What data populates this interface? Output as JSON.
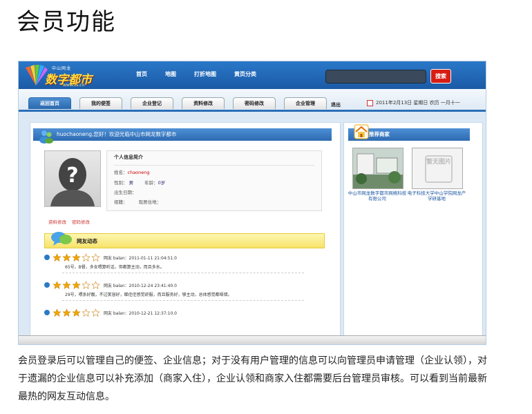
{
  "page_title": "会员功能",
  "site": {
    "logo_text": "数字都市",
    "logo_sub": "中山网龙",
    "logo_url": "www.zs.cn",
    "nav": [
      "首页",
      "地图",
      "打折地图",
      "黄页分类"
    ],
    "search_button": "搜索"
  },
  "tabs": [
    {
      "label": "返回首页",
      "active": true
    },
    {
      "label": "我的便签",
      "active": false
    },
    {
      "label": "企业登记",
      "active": false
    },
    {
      "label": "资料修改",
      "active": false
    },
    {
      "label": "密码修改",
      "active": false
    },
    {
      "label": "企业管理",
      "active": false
    }
  ],
  "logout": "退出",
  "date": "2011年2月13日  星期日  农历 一月十一",
  "welcome": "huochaoneng,您好！欢迎光临中山市网龙数字都市",
  "profile": {
    "title": "个人信息简介",
    "name_label": "姓名：",
    "name_value": "chaoneng",
    "gender_label": "性别：",
    "gender_value": "男",
    "age_label": "年龄：",
    "age_value": "0岁",
    "birthday_label": "出生日期：",
    "hometown_label": "祖籍：",
    "residence_label": "现居住地："
  },
  "edit_links": [
    "资料修改",
    "密码修改"
  ],
  "friends_title": "网友动态",
  "feed": [
    {
      "meta": "网友  balan：2011-01-11 21:04:51.0",
      "text": "65号，B餐，多女喂算听话，但都算主动，而且多水。",
      "stars": 3
    },
    {
      "meta": "网友  balan：2010-12-24 23:41:40.0",
      "text": "29号，喂系好靓，不过笑容好，睇佢佢感觉舒服，而且服务好，够主动，总体感觉都唔错。",
      "stars": 3
    },
    {
      "meta": "网友  balan：2010-12-21 12:37:10.0",
      "text": "",
      "stars": 3
    }
  ],
  "recommend": {
    "title": "推荐商家",
    "placeholder_text": "暂无图片",
    "items": [
      {
        "caption": "中山市网龙数字都市网络科技有限公司"
      },
      {
        "caption": "电子科技大学中山学院网龙产学研基地"
      }
    ]
  },
  "caption": "会员登录后可以管理自己的便签、企业信息；对于没有用户管理的信息可以向管理员申请管理（企业认领），对于遗漏的企业信息可以补充添加（商家入住），企业认领和商家入住都需要后台管理员审核。可以看到当前最新最热的网友互动信息。",
  "colors": {
    "header_blue": "#1b5aa6",
    "search_red": "#d81d14",
    "star_gold": "#f0a800"
  }
}
